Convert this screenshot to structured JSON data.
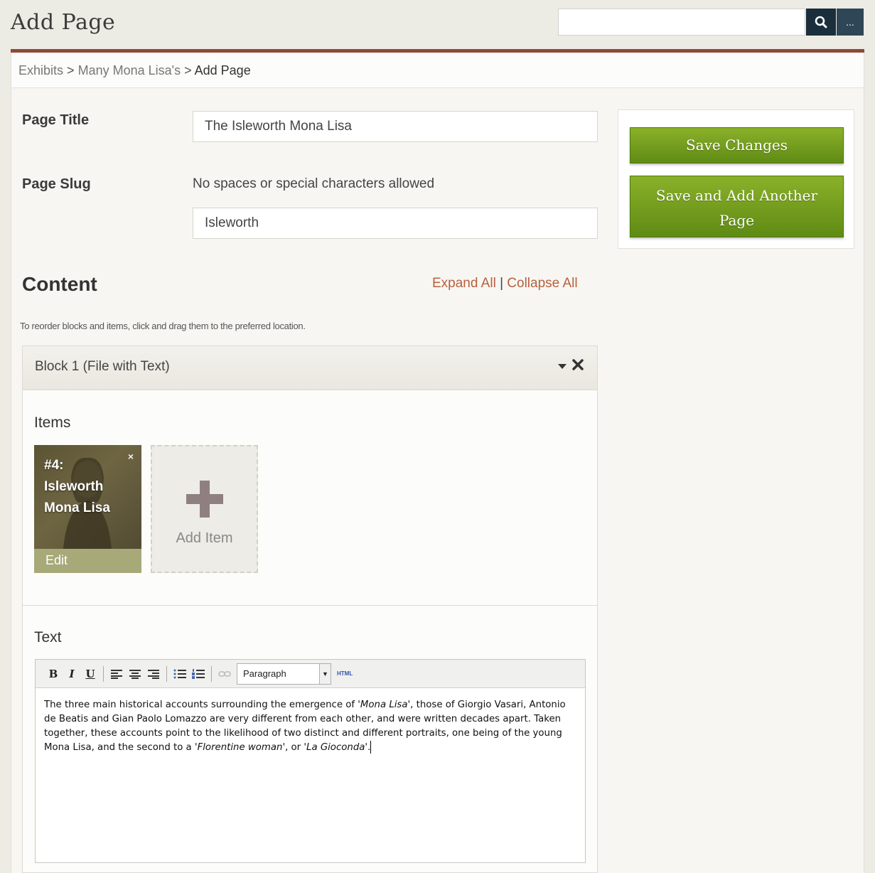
{
  "header": {
    "title": "Add Page",
    "search_value": "",
    "search_more_label": "..."
  },
  "breadcrumb": {
    "items": [
      "Exhibits",
      "Many Mona Lisa's"
    ],
    "separator": ">",
    "current": "Add Page"
  },
  "form": {
    "page_title_label": "Page Title",
    "page_title_value": "The Isleworth Mona Lisa",
    "page_slug_label": "Page Slug",
    "page_slug_hint": "No spaces or special characters allowed",
    "page_slug_value": "Isleworth"
  },
  "actions": {
    "save_label": "Save Changes",
    "save_add_line1": "Save and Add Another",
    "save_add_line2": "Page"
  },
  "content": {
    "heading": "Content",
    "expand_all": "Expand All",
    "link_separator": "|",
    "collapse_all": "Collapse All",
    "reorder_hint": "To reorder blocks and items, click and drag them to the preferred location."
  },
  "block": {
    "title": "Block 1 (File with Text)",
    "items_heading": "Items",
    "item": {
      "title_line1": "#4:",
      "title_line2": "Isleworth",
      "title_line3": "Mona Lisa",
      "remove_label": "×",
      "edit_label": "Edit"
    },
    "add_item_label": "Add Item",
    "text_heading": "Text"
  },
  "editor": {
    "bold": "B",
    "italic": "I",
    "underline": "U",
    "format_value": "Paragraph",
    "html_label": "HTML",
    "body_part1": "The three main historical accounts surrounding the emergence of '",
    "body_italic1": "Mona Lisa",
    "body_part2": "', those of Giorgio Vasari, Antonio de Beatis and Gian Paolo Lomazzo are very different from each other, and were written decades apart. Taken together, these accounts point to the likelihood of two distinct and different portraits, one being of the young Mona Lisa, and the second to a '",
    "body_italic2": "Florentine woman",
    "body_part3": "', or '",
    "body_italic3": "La Gioconda",
    "body_part4": "'."
  },
  "colors": {
    "accent_rule": "#8d4a36",
    "link": "#b8603e",
    "button_green": "#6f9a1c",
    "search_button": "#1a2e3c"
  }
}
